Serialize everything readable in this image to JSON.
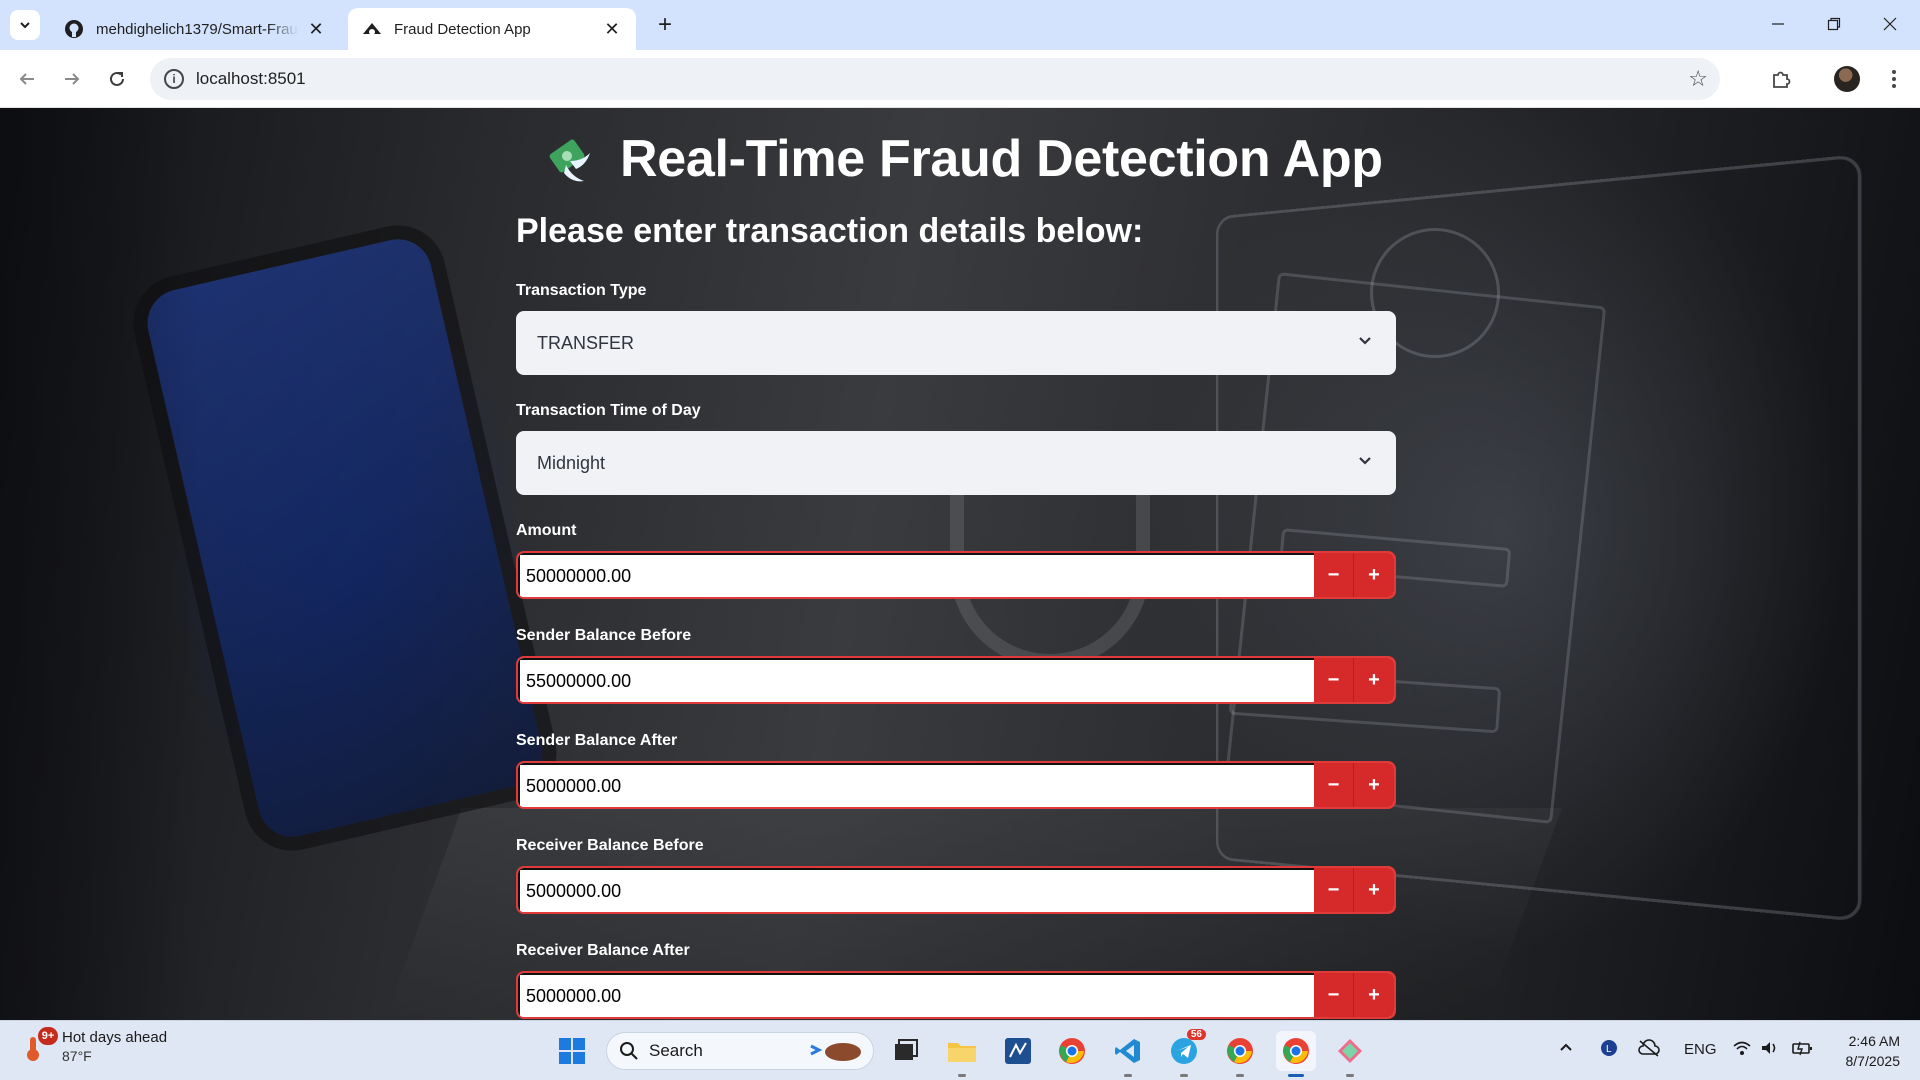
{
  "browser": {
    "tabs": [
      {
        "title": "mehdighelich1379/Smart-Fraud-Detection",
        "icon": "github-icon",
        "active": false
      },
      {
        "title": "Fraud Detection App",
        "icon": "streamlit-icon",
        "active": true
      }
    ],
    "url": "localhost:8501"
  },
  "app": {
    "title": "Real-Time Fraud Detection App",
    "subheading": "Please enter transaction details below:",
    "transaction_type": {
      "label": "Transaction Type",
      "value": "TRANSFER"
    },
    "time_of_day": {
      "label": "Transaction Time of Day",
      "value": "Midnight"
    },
    "amount": {
      "label": "Amount",
      "value": "50000000.00"
    },
    "sender_before": {
      "label": "Sender Balance Before",
      "value": "55000000.00"
    },
    "sender_after": {
      "label": "Sender Balance After",
      "value": "5000000.00"
    },
    "receiver_before": {
      "label": "Receiver Balance Before",
      "value": "5000000.00"
    },
    "receiver_after": {
      "label": "Receiver Balance After",
      "value": "5000000.00"
    },
    "stepper": {
      "minus": "−",
      "plus": "+"
    },
    "accent_color": "#d62a2a"
  },
  "taskbar": {
    "weather": {
      "text": "Hot days ahead",
      "temp": "87°F",
      "badge": "9+"
    },
    "search_label": "Search",
    "telegram_badge": "56",
    "language": "ENG",
    "time": "2:46 AM",
    "date": "8/7/2025"
  }
}
